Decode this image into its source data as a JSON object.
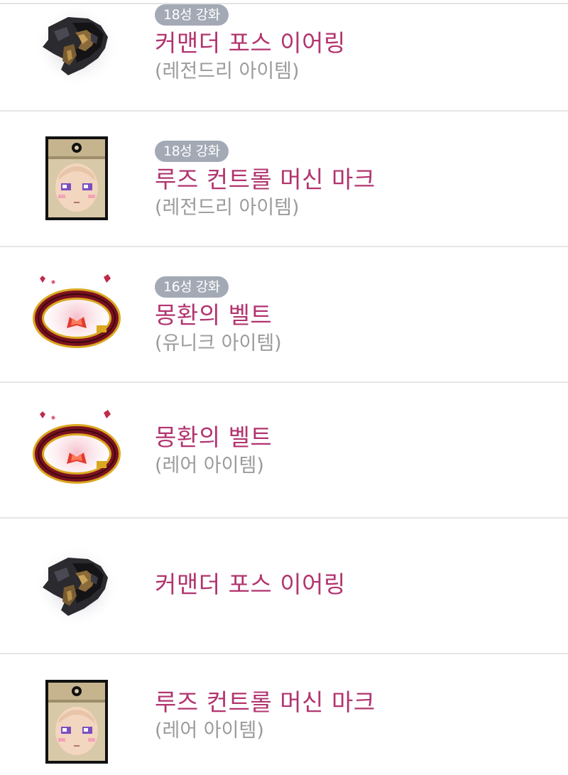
{
  "items": [
    {
      "icon": "earring-icon",
      "enhancement": "18성 강화",
      "name": "커맨더 포스 이어링",
      "grade": "(레전드리 아이템)"
    },
    {
      "icon": "machine-mark-icon",
      "enhancement": "18성 강화",
      "name": "루즈 컨트롤 머신 마크",
      "grade": "(레전드리 아이템)"
    },
    {
      "icon": "belt-icon",
      "enhancement": "16성 강화",
      "name": "몽환의 벨트",
      "grade": "(유니크 아이템)"
    },
    {
      "icon": "belt-icon",
      "name": "몽환의 벨트",
      "grade": "(레어 아이템)"
    },
    {
      "icon": "earring-icon",
      "name": "커맨더 포스 이어링"
    },
    {
      "icon": "machine-mark-icon",
      "name": "루즈 컨트롤 머신 마크",
      "grade": "(레어 아이템)"
    }
  ],
  "colors": {
    "item_name": "#b2346f",
    "grade_text": "#9b9b9b",
    "badge_bg": "#a4a9b6",
    "divider": "#e6e6e6"
  }
}
